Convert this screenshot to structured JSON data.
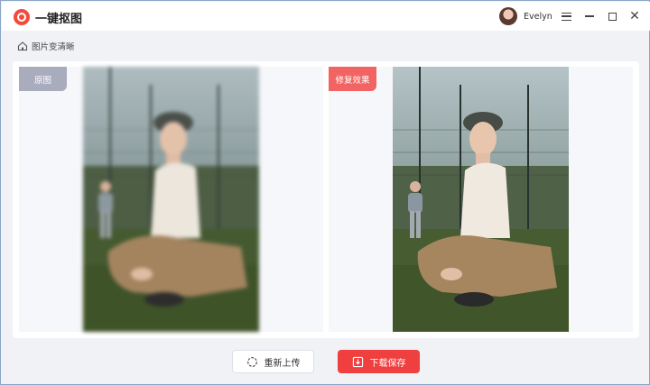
{
  "app": {
    "title": "一键抠图"
  },
  "user": {
    "name": "Evelyn"
  },
  "breadcrumb": {
    "label": "图片变清晰"
  },
  "panels": {
    "original_label": "原图",
    "result_label": "修复效果"
  },
  "actions": {
    "reupload_label": "重新上传",
    "download_label": "下载保存"
  },
  "colors": {
    "accent_red": "#f03f3f",
    "tag_gray": "#a9acbd",
    "tag_red": "#f26363"
  }
}
